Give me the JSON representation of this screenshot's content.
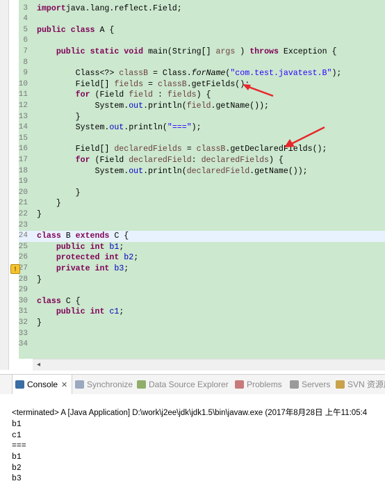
{
  "editor": {
    "lines": [
      {
        "n": "3",
        "segs": [
          [
            "kw",
            "import"
          ],
          [
            "",
            "java.lang.reflect.Field;"
          ]
        ]
      },
      {
        "n": "4",
        "segs": []
      },
      {
        "n": "5",
        "segs": [
          [
            "kw",
            "public"
          ],
          [
            "",
            " "
          ],
          [
            "kw",
            "class"
          ],
          [
            "",
            " A {"
          ]
        ]
      },
      {
        "n": "6",
        "segs": []
      },
      {
        "n": "7",
        "segs": [
          [
            "",
            "    "
          ],
          [
            "kw",
            "public"
          ],
          [
            "",
            " "
          ],
          [
            "kw",
            "static"
          ],
          [
            "",
            " "
          ],
          [
            "kw",
            "void"
          ],
          [
            "",
            " main(String[] "
          ],
          [
            "lv",
            "args"
          ],
          [
            "",
            " ) "
          ],
          [
            "kw",
            "throws"
          ],
          [
            "",
            " Exception {"
          ]
        ]
      },
      {
        "n": "8",
        "segs": []
      },
      {
        "n": "9",
        "segs": [
          [
            "",
            "        Class<?> "
          ],
          [
            "lv",
            "classB"
          ],
          [
            "",
            " = Class."
          ],
          [
            "ita",
            "forName"
          ],
          [
            "",
            "("
          ],
          [
            "str",
            "\"com.test.javatest.B\""
          ],
          [
            "",
            ");"
          ]
        ]
      },
      {
        "n": "10",
        "segs": [
          [
            "",
            "        Field[] "
          ],
          [
            "lv",
            "fields"
          ],
          [
            "",
            " = "
          ],
          [
            "lv",
            "classB"
          ],
          [
            "",
            ".getFields();"
          ]
        ]
      },
      {
        "n": "11",
        "segs": [
          [
            "",
            "        "
          ],
          [
            "kw",
            "for"
          ],
          [
            "",
            " (Field "
          ],
          [
            "lv",
            "field"
          ],
          [
            "",
            " : "
          ],
          [
            "lv",
            "fields"
          ],
          [
            "",
            ") {"
          ]
        ]
      },
      {
        "n": "12",
        "segs": [
          [
            "",
            "            System."
          ],
          [
            "fld",
            "out"
          ],
          [
            "",
            ".println("
          ],
          [
            "lv",
            "field"
          ],
          [
            "",
            ".getName());"
          ]
        ]
      },
      {
        "n": "13",
        "segs": [
          [
            "",
            "        }"
          ]
        ]
      },
      {
        "n": "14",
        "segs": [
          [
            "",
            "        System."
          ],
          [
            "fld",
            "out"
          ],
          [
            "",
            ".println("
          ],
          [
            "str",
            "\"===\""
          ],
          [
            "",
            ");"
          ]
        ]
      },
      {
        "n": "15",
        "segs": []
      },
      {
        "n": "16",
        "segs": [
          [
            "",
            "        Field[] "
          ],
          [
            "lv",
            "declaredFields"
          ],
          [
            "",
            " = "
          ],
          [
            "lv",
            "classB"
          ],
          [
            "",
            ".getDeclaredFields();"
          ]
        ]
      },
      {
        "n": "17",
        "segs": [
          [
            "",
            "        "
          ],
          [
            "kw",
            "for"
          ],
          [
            "",
            " (Field "
          ],
          [
            "lv",
            "declaredField"
          ],
          [
            "",
            ": "
          ],
          [
            "lv",
            "declaredFields"
          ],
          [
            "",
            ") {"
          ]
        ]
      },
      {
        "n": "18",
        "segs": [
          [
            "",
            "            System."
          ],
          [
            "fld",
            "out"
          ],
          [
            "",
            ".println("
          ],
          [
            "lv",
            "declaredField"
          ],
          [
            "",
            ".getName());"
          ]
        ]
      },
      {
        "n": "19",
        "segs": []
      },
      {
        "n": "20",
        "segs": [
          [
            "",
            "        }"
          ]
        ]
      },
      {
        "n": "21",
        "segs": [
          [
            "",
            "    }"
          ]
        ]
      },
      {
        "n": "22",
        "segs": [
          [
            "",
            "}"
          ]
        ]
      },
      {
        "n": "23",
        "segs": []
      },
      {
        "n": "24",
        "segs": [
          [
            "kw",
            "class"
          ],
          [
            "",
            " B "
          ],
          [
            "kw",
            "extends"
          ],
          [
            "",
            " C {"
          ]
        ]
      },
      {
        "n": "25",
        "segs": [
          [
            "",
            "    "
          ],
          [
            "kw",
            "public"
          ],
          [
            "",
            " "
          ],
          [
            "kw",
            "int"
          ],
          [
            "",
            " "
          ],
          [
            "fld",
            "b1"
          ],
          [
            "",
            ";"
          ]
        ]
      },
      {
        "n": "26",
        "segs": [
          [
            "",
            "    "
          ],
          [
            "kw",
            "protected"
          ],
          [
            "",
            " "
          ],
          [
            "kw",
            "int"
          ],
          [
            "",
            " "
          ],
          [
            "fld",
            "b2"
          ],
          [
            "",
            ";"
          ]
        ]
      },
      {
        "n": "27",
        "segs": [
          [
            "",
            "    "
          ],
          [
            "kw",
            "private"
          ],
          [
            "",
            " "
          ],
          [
            "kw",
            "int"
          ],
          [
            "",
            " "
          ],
          [
            "fld",
            "b3"
          ],
          [
            "",
            ";"
          ]
        ]
      },
      {
        "n": "28",
        "segs": [
          [
            "",
            "}"
          ]
        ]
      },
      {
        "n": "29",
        "segs": []
      },
      {
        "n": "30",
        "segs": [
          [
            "kw",
            "class"
          ],
          [
            "",
            " C {"
          ]
        ]
      },
      {
        "n": "31",
        "segs": [
          [
            "",
            "    "
          ],
          [
            "kw",
            "public"
          ],
          [
            "",
            " "
          ],
          [
            "kw",
            "int"
          ],
          [
            "",
            " "
          ],
          [
            "fld",
            "c1"
          ],
          [
            "",
            ";"
          ]
        ]
      },
      {
        "n": "32",
        "segs": [
          [
            "",
            "}"
          ]
        ]
      },
      {
        "n": "33",
        "segs": []
      },
      {
        "n": "34",
        "segs": []
      }
    ],
    "highlighted_line": "24",
    "warning_line": "27",
    "annotation_color": "#e8262b"
  },
  "console_tabs": [
    {
      "label": "Console",
      "icon": "console-icon",
      "active": true,
      "color": "#3a6ea5"
    },
    {
      "label": "Synchronize",
      "icon": "synchronize-icon",
      "active": false,
      "color": "#9aa8c0"
    },
    {
      "label": "Data Source Explorer",
      "icon": "data-source-icon",
      "active": false,
      "color": "#8fae6a"
    },
    {
      "label": "Problems",
      "icon": "problems-icon",
      "active": false,
      "color": "#c87a7a"
    },
    {
      "label": "Servers",
      "icon": "servers-icon",
      "active": false,
      "color": "#9a9a9a"
    },
    {
      "label": "SVN 资源库",
      "icon": "svn-icon",
      "active": false,
      "color": "#c9a24a"
    }
  ],
  "console": {
    "terminated": "<terminated> A [Java Application] D:\\work\\j2ee\\jdk\\jdk1.5\\bin\\javaw.exe (2017年8月28日 上午11:05:4",
    "output": [
      "b1",
      "c1",
      "===",
      "b1",
      "b2",
      "b3"
    ]
  }
}
